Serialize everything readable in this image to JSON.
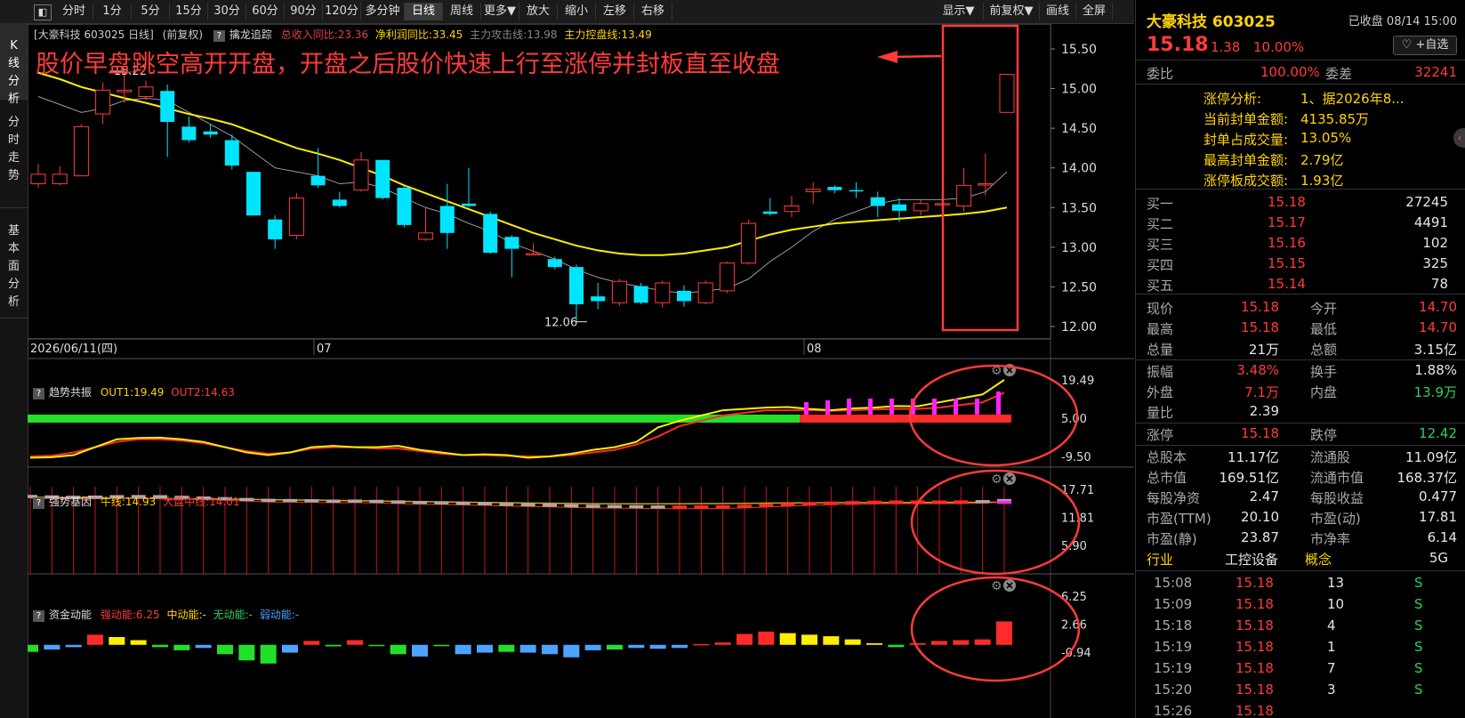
{
  "toolbar": {
    "items": [
      "分时",
      "1分",
      "5分",
      "15分",
      "30分",
      "60分",
      "90分",
      "120分",
      "多分钟",
      "日线",
      "周线",
      "更多▼",
      "放大",
      "缩小",
      "左移",
      "右移",
      "显示▼",
      "前复权▼",
      "画线",
      "全屏"
    ],
    "active": "日线"
  },
  "side_tabs": [
    "K线分析",
    "分时走势",
    "基本面分析"
  ],
  "main_panel": {
    "title": "[大豪科技 603025 日线]",
    "fq": "(前复权)",
    "indicator_name": "擒龙追踪",
    "ind1": "总收入同比:23.36",
    "ind2": "净利润同比:33.45",
    "ind3": "主力攻击线:13.98",
    "ind4": "主力控盘线:13.49",
    "annotation": "股价早盘跳空高开开盘，开盘之后股价快速上行至涨停并封板直至收盘",
    "high_label": "15.22",
    "low_label": "12.06",
    "date_labels": [
      "2026/06/11(四)",
      "07",
      "08"
    ]
  },
  "colors": {
    "up": "#ff3b3b",
    "down": "#00e5ff",
    "ma1": "#9a9a9a",
    "ma2": "#ffee00",
    "annot": "#ff3b3b"
  },
  "sub1": {
    "name": "趋势共振",
    "out1": "OUT1:19.49",
    "out2": "OUT2:14.63",
    "ticks": [
      "19.49",
      "5.00",
      "-9.50"
    ]
  },
  "sub2": {
    "name": "强势基因",
    "bull": "牛线:14.93",
    "market": "大盘中线:14.01",
    "ticks": [
      "17.71",
      "11.81",
      "5.90"
    ]
  },
  "sub3": {
    "name": "资金动能",
    "strong": "强动能:6.25",
    "mid": "中动能:-",
    "none": "无动能:-",
    "weak": "弱动能:-",
    "ticks": [
      "6.25",
      "2.66",
      "-0.94"
    ]
  },
  "chart_data": {
    "type": "candlestick",
    "title": "大豪科技 603025 日线",
    "y_ticks": [
      15.5,
      15.0,
      14.5,
      14.0,
      13.5,
      13.0,
      12.5,
      12.0
    ],
    "ylim": [
      11.9,
      15.6
    ],
    "candles": [
      {
        "o": 13.8,
        "c": 13.92,
        "h": 14.05,
        "l": 13.75
      },
      {
        "o": 13.8,
        "c": 13.92,
        "h": 14.02,
        "l": 13.78
      },
      {
        "o": 13.9,
        "c": 14.52,
        "h": 14.55,
        "l": 13.9
      },
      {
        "o": 14.68,
        "c": 14.98,
        "h": 15.08,
        "l": 14.55
      },
      {
        "o": 14.96,
        "c": 14.98,
        "h": 15.22,
        "l": 14.82
      },
      {
        "o": 14.9,
        "c": 15.02,
        "h": 15.1,
        "l": 14.85
      },
      {
        "o": 14.97,
        "c": 14.58,
        "h": 15.05,
        "l": 14.14
      },
      {
        "o": 14.52,
        "c": 14.35,
        "h": 14.65,
        "l": 14.32
      },
      {
        "o": 14.46,
        "c": 14.42,
        "h": 14.55,
        "l": 14.38
      },
      {
        "o": 14.35,
        "c": 14.03,
        "h": 14.42,
        "l": 13.98
      },
      {
        "o": 13.95,
        "c": 13.4,
        "h": 13.95,
        "l": 13.4
      },
      {
        "o": 13.35,
        "c": 13.1,
        "h": 13.4,
        "l": 12.98
      },
      {
        "o": 13.15,
        "c": 13.62,
        "h": 13.68,
        "l": 13.1
      },
      {
        "o": 13.9,
        "c": 13.78,
        "h": 14.25,
        "l": 13.75
      },
      {
        "o": 13.6,
        "c": 13.52,
        "h": 13.7,
        "l": 13.5
      },
      {
        "o": 13.72,
        "c": 14.1,
        "h": 14.2,
        "l": 13.7
      },
      {
        "o": 14.1,
        "c": 13.62,
        "h": 14.1,
        "l": 13.6
      },
      {
        "o": 13.75,
        "c": 13.28,
        "h": 13.78,
        "l": 13.25
      },
      {
        "o": 13.1,
        "c": 13.18,
        "h": 13.5,
        "l": 13.08
      },
      {
        "o": 13.52,
        "c": 13.18,
        "h": 13.8,
        "l": 12.98
      },
      {
        "o": 13.55,
        "c": 13.52,
        "h": 14.0,
        "l": 13.5
      },
      {
        "o": 13.42,
        "c": 12.93,
        "h": 13.45,
        "l": 12.92
      },
      {
        "o": 13.13,
        "c": 12.98,
        "h": 13.15,
        "l": 12.62
      },
      {
        "o": 12.92,
        "c": 12.92,
        "h": 13.05,
        "l": 12.9
      },
      {
        "o": 12.85,
        "c": 12.75,
        "h": 12.88,
        "l": 12.72
      },
      {
        "o": 12.75,
        "c": 12.28,
        "h": 12.78,
        "l": 12.06
      },
      {
        "o": 12.38,
        "c": 12.32,
        "h": 12.55,
        "l": 12.22
      },
      {
        "o": 12.3,
        "c": 12.57,
        "h": 12.6,
        "l": 12.26
      },
      {
        "o": 12.51,
        "c": 12.3,
        "h": 12.55,
        "l": 12.28
      },
      {
        "o": 12.3,
        "c": 12.55,
        "h": 12.58,
        "l": 12.24
      },
      {
        "o": 12.45,
        "c": 12.32,
        "h": 12.52,
        "l": 12.25
      },
      {
        "o": 12.3,
        "c": 12.55,
        "h": 12.58,
        "l": 12.28
      },
      {
        "o": 12.45,
        "c": 12.8,
        "h": 12.82,
        "l": 12.42
      },
      {
        "o": 12.8,
        "c": 13.3,
        "h": 13.35,
        "l": 12.78
      },
      {
        "o": 13.45,
        "c": 13.42,
        "h": 13.62,
        "l": 13.4
      },
      {
        "o": 13.45,
        "c": 13.52,
        "h": 13.65,
        "l": 13.38
      },
      {
        "o": 13.7,
        "c": 13.73,
        "h": 13.82,
        "l": 13.55
      },
      {
        "o": 13.76,
        "c": 13.72,
        "h": 13.78,
        "l": 13.68
      },
      {
        "o": 13.72,
        "c": 13.71,
        "h": 13.82,
        "l": 13.62
      },
      {
        "o": 13.63,
        "c": 13.52,
        "h": 13.7,
        "l": 13.38
      },
      {
        "o": 13.54,
        "c": 13.46,
        "h": 13.62,
        "l": 13.32
      },
      {
        "o": 13.46,
        "c": 13.55,
        "h": 13.6,
        "l": 13.4
      },
      {
        "o": 13.55,
        "c": 13.55,
        "h": 13.68,
        "l": 13.45
      },
      {
        "o": 13.52,
        "c": 13.78,
        "h": 14.0,
        "l": 13.45
      },
      {
        "o": 13.8,
        "c": 13.8,
        "h": 14.18,
        "l": 13.65
      },
      {
        "o": 14.7,
        "c": 15.18,
        "h": 15.18,
        "l": 14.7
      }
    ],
    "ma_short": [
      14.9,
      14.8,
      14.7,
      14.75,
      14.85,
      14.88,
      14.85,
      14.7,
      14.55,
      14.4,
      14.2,
      14.0,
      13.95,
      13.9,
      13.8,
      13.82,
      13.75,
      13.62,
      13.5,
      13.42,
      13.3,
      13.2,
      13.05,
      12.95,
      12.85,
      12.72,
      12.62,
      12.55,
      12.5,
      12.45,
      12.42,
      12.45,
      12.48,
      12.6,
      12.82,
      13.0,
      13.2,
      13.35,
      13.45,
      13.55,
      13.6,
      13.6,
      13.6,
      13.62,
      13.7,
      13.95
    ],
    "ma_long": [
      15.2,
      15.12,
      15.02,
      14.95,
      14.88,
      14.82,
      14.75,
      14.68,
      14.62,
      14.55,
      14.45,
      14.35,
      14.25,
      14.18,
      14.1,
      14.0,
      13.9,
      13.78,
      13.68,
      13.58,
      13.48,
      13.38,
      13.28,
      13.18,
      13.1,
      13.02,
      12.96,
      12.92,
      12.9,
      12.9,
      12.92,
      12.96,
      13.0,
      13.08,
      13.16,
      13.22,
      13.26,
      13.3,
      13.32,
      13.34,
      13.36,
      13.38,
      13.4,
      13.42,
      13.45,
      13.5
    ],
    "macd_bars": [
      -0.9,
      -0.6,
      -0.3,
      1.3,
      1.0,
      0.6,
      -0.3,
      -0.7,
      -0.4,
      -1.2,
      -2.0,
      -2.4,
      -1.0,
      0.5,
      -0.2,
      0.6,
      -0.1,
      -1.2,
      -1.5,
      -0.1,
      -1.2,
      -1.0,
      -0.9,
      -1.0,
      -1.2,
      -1.6,
      -0.7,
      -0.6,
      -0.4,
      -0.5,
      -0.4,
      0.1,
      0.3,
      1.4,
      1.7,
      1.5,
      1.3,
      1.1,
      0.7,
      0.2,
      -0.3,
      0.2,
      0.5,
      0.6,
      0.7,
      3.0
    ],
    "macd_colors": [
      "g",
      "b",
      "b",
      "r",
      "y",
      "y",
      "g",
      "g",
      "b",
      "g",
      "g",
      "g",
      "b",
      "r",
      "g",
      "r",
      "g",
      "g",
      "b",
      "g",
      "b",
      "b",
      "g",
      "b",
      "b",
      "b",
      "b",
      "g",
      "b",
      "b",
      "b",
      "r",
      "r",
      "r",
      "r",
      "y",
      "y",
      "y",
      "y",
      "y",
      "g",
      "r",
      "r",
      "r",
      "r",
      "r"
    ]
  },
  "right_panel": {
    "stock": "大豪科技 603025",
    "status": "已收盘 08/14 15:00",
    "price": "15.18",
    "change": "1.38",
    "pct": "10.00%",
    "watch_btn": "♡ +自选",
    "wb_label": "委比",
    "wb": "100.00%",
    "wc_label": "委差",
    "wc": "32241",
    "zt_lines": [
      {
        "k": "涨停分析:",
        "v": "1、据2026年8..."
      },
      {
        "k": "当前封单金额:",
        "v": "4135.85万"
      },
      {
        "k": "封单占成交量:",
        "v": "13.05%"
      },
      {
        "k": "最高封单金额:",
        "v": "2.79亿"
      },
      {
        "k": "涨停板成交额:",
        "v": "1.93亿"
      }
    ],
    "bids": [
      {
        "label": "买一",
        "price": "15.18",
        "vol": "27245"
      },
      {
        "label": "买二",
        "price": "15.17",
        "vol": "4491"
      },
      {
        "label": "买三",
        "price": "15.16",
        "vol": "102"
      },
      {
        "label": "买四",
        "price": "15.15",
        "vol": "325"
      },
      {
        "label": "买五",
        "price": "15.14",
        "vol": "78"
      }
    ],
    "stats": [
      {
        "l1": "现价",
        "v1": "15.18",
        "c1": "red",
        "l2": "今开",
        "v2": "14.70",
        "c2": "red"
      },
      {
        "l1": "最高",
        "v1": "15.18",
        "c1": "red",
        "l2": "最低",
        "v2": "14.70",
        "c2": "red"
      },
      {
        "l1": "总量",
        "v1": "21万",
        "c1": "white",
        "l2": "总额",
        "v2": "3.15亿",
        "c2": "white"
      },
      {
        "l1": "振幅",
        "v1": "3.48%",
        "c1": "red",
        "l2": "换手",
        "v2": "1.88%",
        "c2": "white"
      },
      {
        "l1": "外盘",
        "v1": "7.1万",
        "c1": "red",
        "l2": "内盘",
        "v2": "13.9万",
        "c2": "green"
      },
      {
        "l1": "量比",
        "v1": "2.39",
        "c1": "white",
        "l2": "",
        "v2": "",
        "c2": "white"
      },
      {
        "l1": "涨停",
        "v1": "15.18",
        "c1": "red",
        "l2": "跌停",
        "v2": "12.42",
        "c2": "green"
      },
      {
        "l1": "总股本",
        "v1": "11.17亿",
        "c1": "white",
        "l2": "流通股",
        "v2": "11.09亿",
        "c2": "white"
      },
      {
        "l1": "总市值",
        "v1": "169.51亿",
        "c1": "white",
        "l2": "流通市值",
        "v2": "168.37亿",
        "c2": "white"
      },
      {
        "l1": "每股净资",
        "v1": "2.47",
        "c1": "white",
        "l2": "每股收益",
        "v2": "0.477",
        "c2": "white"
      },
      {
        "l1": "市盈(TTM)",
        "v1": "20.10",
        "c1": "white",
        "l2": "市盈(动)",
        "v2": "17.81",
        "c2": "white"
      },
      {
        "l1": "市盈(静)",
        "v1": "23.87",
        "c1": "white",
        "l2": "市净率",
        "v2": "6.14",
        "c2": "white"
      }
    ],
    "industry_label": "行业",
    "industry": "工控设备",
    "concept_label": "概念",
    "concept": "5G",
    "ticks": [
      {
        "t": "15:08",
        "p": "15.18",
        "v": "13",
        "s": "S"
      },
      {
        "t": "15:09",
        "p": "15.18",
        "v": "10",
        "s": "S"
      },
      {
        "t": "15:18",
        "p": "15.18",
        "v": "4",
        "s": "S"
      },
      {
        "t": "15:19",
        "p": "15.18",
        "v": "1",
        "s": "S"
      },
      {
        "t": "15:19",
        "p": "15.18",
        "v": "7",
        "s": "S"
      },
      {
        "t": "15:20",
        "p": "15.18",
        "v": "3",
        "s": "S"
      },
      {
        "t": "15:26",
        "p": "15.18",
        "v": "",
        "s": ""
      }
    ]
  }
}
